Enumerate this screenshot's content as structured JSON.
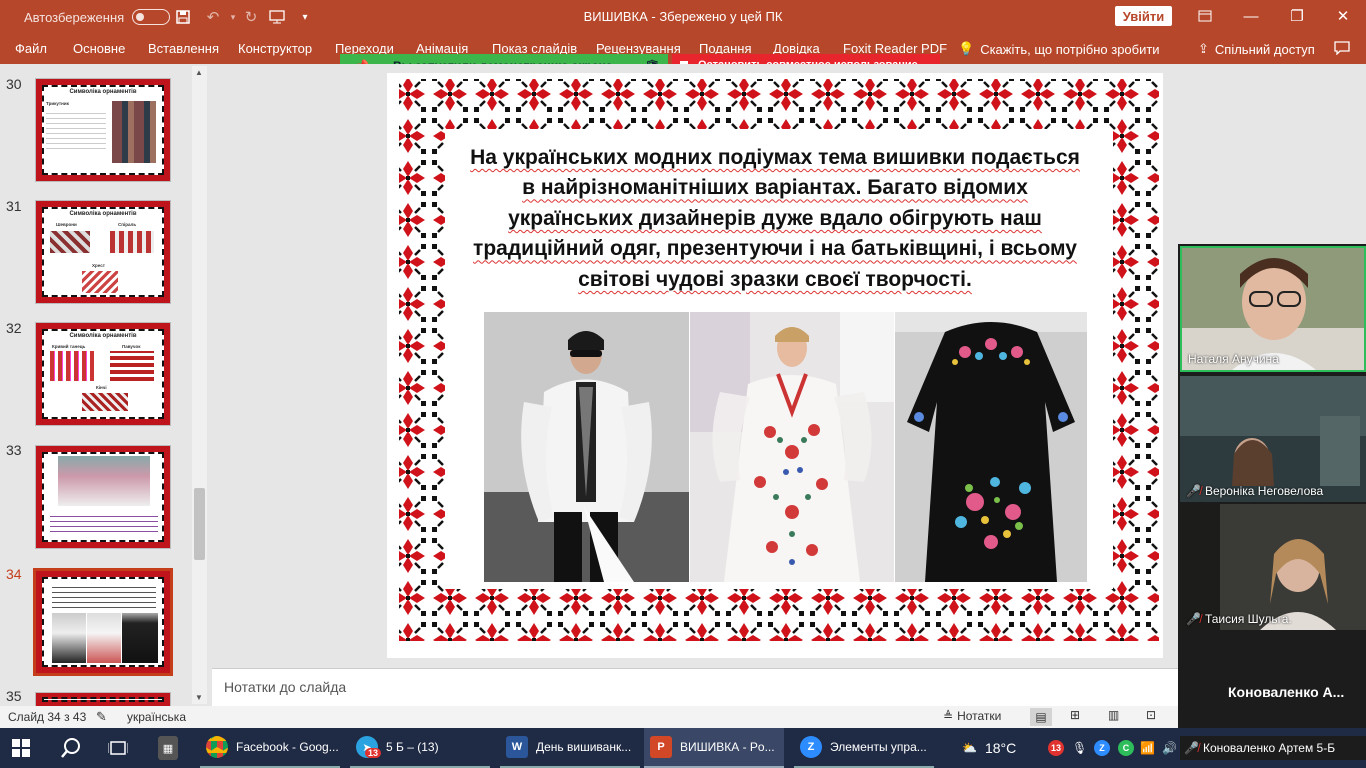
{
  "titlebar": {
    "autosave_label": "Автозбереження",
    "doc_title": "ВИШИВКА  -  Збережено у цей ПК",
    "signin_label": "Увійти"
  },
  "ribbon": {
    "tabs": [
      "Файл",
      "Основне",
      "Вставлення",
      "Конструктор",
      "Переходи",
      "Анімація",
      "Показ слайдів",
      "Рецензування",
      "Подання",
      "Довідка",
      "Foxit Reader PDF"
    ],
    "tell_me": "Скажіть, що потрібно зробити",
    "share": "Спільний доступ"
  },
  "share_banner": {
    "text": "Вы запустили демонстрацию экрана",
    "stop": "Остановить совместное использование"
  },
  "thumbnails": [
    {
      "num": "30",
      "title": "Символіка орнаментів",
      "sub": "Трикутник"
    },
    {
      "num": "31",
      "title": "Символіка орнаментів",
      "labels": [
        "Шеврони",
        "Спіраль",
        "Хрест"
      ]
    },
    {
      "num": "32",
      "title": "Символіка орнаментів",
      "labels": [
        "Кривий танець",
        "Павучок",
        "Кінчі"
      ]
    },
    {
      "num": "33"
    },
    {
      "num": "34"
    },
    {
      "num": "35"
    }
  ],
  "slide": {
    "text": "На українських модних подіумах тема вишивки подається в найрізноманітніших варіантах. Багато відомих українських дизайнерів дуже вдало обігрують наш традиційний одяг, презентуючи і на батьківщині, і всьому світові чудові зразки своєї творчості."
  },
  "notes_placeholder": "Нотатки до слайда",
  "statusbar": {
    "slide_count": "Слайд 34 з 43",
    "language": "українська",
    "notes_btn": "Нотатки"
  },
  "participants": [
    {
      "name": "Наталя Анучина"
    },
    {
      "name": "Вероніка Неговелова"
    },
    {
      "name": "Таисия Шульга."
    },
    {
      "name": "Коноваленко  А..."
    }
  ],
  "taskbar": {
    "items": [
      "Facebook - Goog...",
      "5 Б – (13)",
      "День вишиванк...",
      "ВИШИВКА - Po...",
      "Элементы упра..."
    ],
    "telegram_badge": "13",
    "weather": "18°C",
    "tray_badge": "13",
    "speaker_name": "Коноваленко Артем 5-Б"
  },
  "colors": {
    "accent": "#b7472a",
    "embroidery_red": "#d0121b",
    "embroidery_black": "#111111"
  }
}
